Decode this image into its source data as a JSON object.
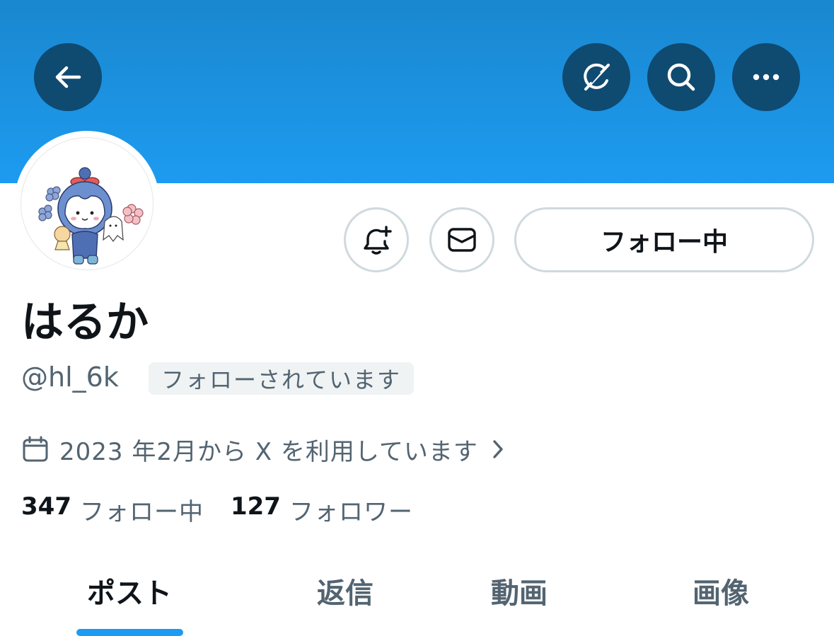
{
  "header": {
    "back_icon": "arrow-left-icon",
    "grok_icon": "grok-icon",
    "search_icon": "search-icon",
    "more_icon": "more-horizontal-icon",
    "banner_color": "#1d9bf0"
  },
  "profile": {
    "display_name": "はるか",
    "handle": "@hl_6k",
    "follows_you_badge": "フォローされています",
    "joined": "2023 年2月から X を利用しています",
    "following_count": "347",
    "following_label": "フォロー中",
    "followers_count": "127",
    "followers_label": "フォロワー"
  },
  "actions": {
    "notify_icon": "bell-plus-icon",
    "message_icon": "mail-icon",
    "follow_button_label": "フォロー中"
  },
  "tabs": [
    {
      "label": "ポスト",
      "active": true
    },
    {
      "label": "返信",
      "active": false
    },
    {
      "label": "動画",
      "active": false
    },
    {
      "label": "画像",
      "active": false
    }
  ],
  "colors": {
    "accent": "#1d9bf0",
    "text_primary": "#0f1419",
    "text_secondary": "#536471",
    "border": "#cfd9de"
  }
}
